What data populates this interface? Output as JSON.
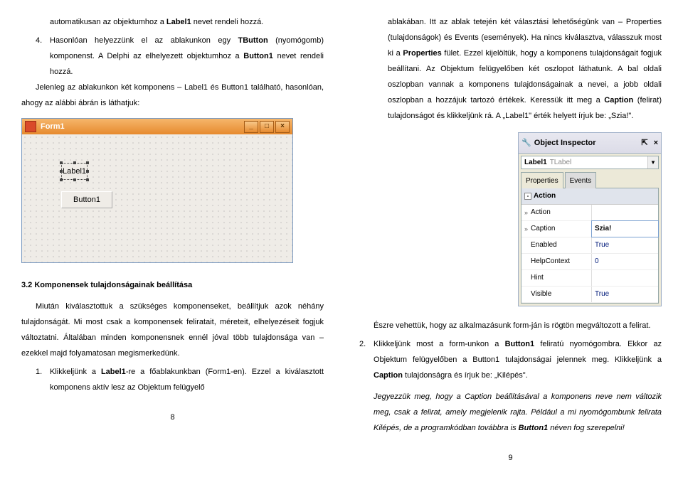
{
  "left": {
    "p1": "automatikusan az objektumhoz a ",
    "p1b": "Label1",
    "p1c": " nevet rendeli hozzá.",
    "li4a": "Hasonlóan helyezzünk el az ablakunkon egy ",
    "li4b": "TButton",
    "li4c": " (nyomógomb) komponenst. A Delphi az elhelyezett objektumhoz a ",
    "li4d": "Button1",
    "li4e": " nevet rendeli hozzá.",
    "p2": "Jelenleg az ablakunkon két komponens – Label1 és Button1 található, hasonlóan, ahogy az alábbi ábrán is láthatjuk:",
    "form1": {
      "title": "Form1",
      "label": "Label1",
      "button": "Button1",
      "min": "_",
      "max": "□",
      "close": "×"
    },
    "h32": "3.2 Komponensek tulajdonságainak beállítása",
    "p3": "Miután kiválasztottuk a szükséges komponenseket, beállítjuk azok néhány tulajdonságát. Mi most csak a komponensek feliratait, méreteit, elhelyezéseit fogjuk változtatni. Általában minden komponensnek ennél jóval több tulajdonsága van – ezekkel majd folyamatosan megismerkedünk.",
    "li1a": "Klikkeljünk a ",
    "li1b": "Label1",
    "li1c": "-re a főablakunkban (Form1-en). Ezzel a kiválasztott komponens aktív lesz az Objektum felügyelő",
    "pagenum": "8"
  },
  "right": {
    "p1a": "ablakában. Itt az ablak tetején két választási lehetőségünk van – Properties (tulajdonságok) és Events (események). Ha nincs kiválasztva, válasszuk most ki a ",
    "p1b": "Properties",
    "p1c": " fület. Ezzel kijelöltük, hogy a komponens tulajdonságait fogjuk beállítani. Az Objektum felügyelőben két oszlopot láthatunk. A bal oldali oszlopban vannak a komponens tulajdonságainak a nevei, a jobb oldali oszlopban a hozzájuk tartozó értékek. Keressük itt meg a ",
    "p1d": "Caption",
    "p1e": " (felirat) tulajdonságot és klikkeljünk rá. A „Label1\" érték helyett írjuk be: „Szia!\".",
    "inspector": {
      "title": "Object Inspector",
      "combo_name": "Label1",
      "combo_type": "TLabel",
      "tab_props": "Properties",
      "tab_events": "Events",
      "section": "Action",
      "rows": [
        {
          "prop": "Action",
          "val": "",
          "tw": "»"
        },
        {
          "prop": "Caption",
          "val": "Szia!",
          "tw": "»",
          "editing": true
        },
        {
          "prop": "Enabled",
          "val": "True",
          "tw": ""
        },
        {
          "prop": "HelpContext",
          "val": "0",
          "tw": ""
        },
        {
          "prop": "Hint",
          "val": "",
          "tw": ""
        },
        {
          "prop": "Visible",
          "val": "True",
          "tw": ""
        }
      ],
      "pin": "⇱",
      "close": "×"
    },
    "p2": "Észre vehettük, hogy az alkalmazásunk form-ján is rögtön megváltozott a felirat.",
    "li2a": "Klikkeljünk most a form-unkon a ",
    "li2b": "Button1",
    "li2c": " feliratú nyomógombra. Ekkor az Objektum felügyelőben a Button1 tulajdonságai jelennek meg. Klikkeljünk a ",
    "li2d": "Caption",
    "li2e": " tulajdonságra és írjuk be: „Kilépés\".",
    "p3a": "Jegyezzük meg, hogy a Caption beállításával a komponens neve nem változik meg, csak a felirat, amely megjelenik rajta. Például a mi nyomógombunk felirata Kilépés, de a programkódban továbbra is ",
    "p3b": "Button1",
    "p3c": " néven fog szerepelni!",
    "pagenum": "9"
  },
  "listnum4": "4.",
  "listnum1": "1.",
  "listnum2": "2."
}
